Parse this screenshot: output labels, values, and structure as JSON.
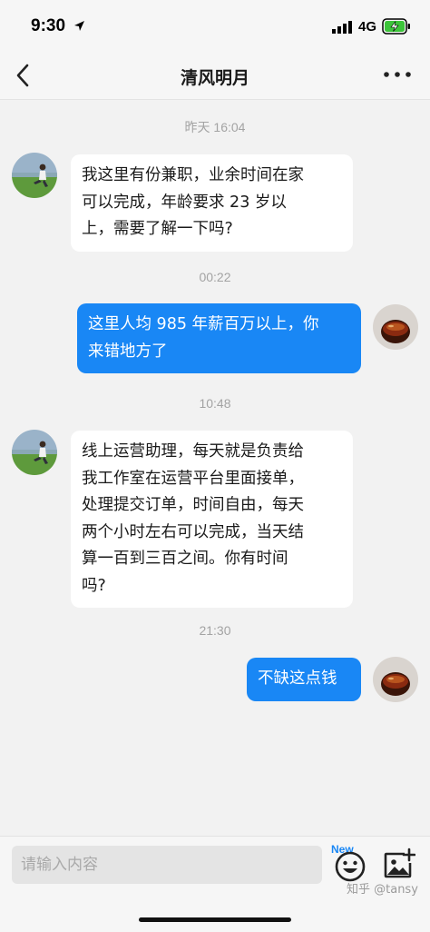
{
  "status_bar": {
    "time": "9:30",
    "network": "4G",
    "icons": [
      "location-arrow-icon",
      "signal-icon",
      "battery-charging-icon"
    ]
  },
  "nav": {
    "title": "清风明月",
    "back_icon": "chevron-left-icon",
    "more_icon": "more-dots-icon"
  },
  "chat": {
    "messages": [
      {
        "kind": "timestamp",
        "text": "昨天 16:04"
      },
      {
        "kind": "incoming",
        "lines": [
          "我这里有份兼职，业余时间在家",
          "可以完成，年龄要求 23 岁以",
          "上，需要了解一下吗?"
        ]
      },
      {
        "kind": "timestamp",
        "text": "00:22"
      },
      {
        "kind": "outgoing",
        "lines": [
          "这里人均 985 年薪百万以上，你",
          "来错地方了"
        ]
      },
      {
        "kind": "timestamp",
        "text": "10:48"
      },
      {
        "kind": "incoming",
        "lines": [
          "线上运营助理，每天就是负责给",
          "我工作室在运营平台里面接单，",
          "处理提交订单，时间自由，每天",
          "两个小时左右可以完成，当天结",
          "算一百到三百之间。你有时间",
          "吗?"
        ]
      },
      {
        "kind": "timestamp",
        "text": "21:30"
      },
      {
        "kind": "outgoing",
        "lines": [
          "不缺这点钱"
        ]
      }
    ]
  },
  "input_bar": {
    "placeholder": "请输入内容",
    "new_badge": "New",
    "emoji_icon": "emoji-icon",
    "image_icon": "add-image-icon"
  },
  "watermark": "知乎 @tansy",
  "colors": {
    "accent": "#1987f5",
    "chat_background": "#f2f2f2",
    "incoming_bubble": "#ffffff",
    "outgoing_bubble": "#1987f5"
  }
}
